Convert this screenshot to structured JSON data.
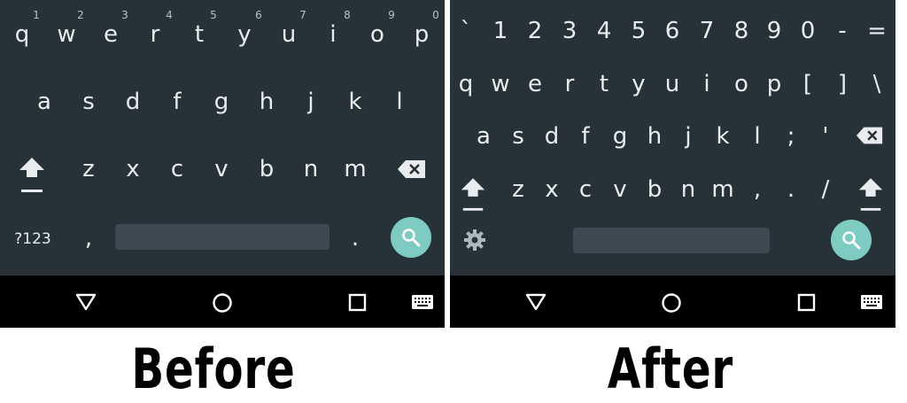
{
  "before": {
    "number_hints": [
      "1",
      "2",
      "3",
      "4",
      "5",
      "6",
      "7",
      "8",
      "9",
      "0"
    ],
    "row1": [
      "q",
      "w",
      "e",
      "r",
      "t",
      "y",
      "u",
      "i",
      "o",
      "p"
    ],
    "row2": [
      "a",
      "s",
      "d",
      "f",
      "g",
      "h",
      "j",
      "k",
      "l"
    ],
    "row3": [
      "z",
      "x",
      "c",
      "v",
      "b",
      "n",
      "m"
    ],
    "symbols_key": "?123",
    "comma": ",",
    "period": ".",
    "caption": "Before"
  },
  "after": {
    "row0": [
      "`",
      "1",
      "2",
      "3",
      "4",
      "5",
      "6",
      "7",
      "8",
      "9",
      "0",
      "-",
      "="
    ],
    "row1": [
      "q",
      "w",
      "e",
      "r",
      "t",
      "y",
      "u",
      "i",
      "o",
      "p",
      "[",
      "]",
      "\\"
    ],
    "row2": [
      "a",
      "s",
      "d",
      "f",
      "g",
      "h",
      "j",
      "k",
      "l",
      ";",
      "'"
    ],
    "row3": [
      "z",
      "x",
      "c",
      "v",
      "b",
      "n",
      "m",
      ",",
      ".",
      "/"
    ],
    "caption": "After"
  },
  "icons": {
    "shift": "shift-icon",
    "backspace": "backspace-icon",
    "search": "search-icon",
    "settings": "gear-icon",
    "nav_back": "back-triangle-icon",
    "nav_home": "home-circle-icon",
    "nav_recents": "recents-square-icon",
    "nav_keyboard": "keyboard-icon"
  },
  "colors": {
    "keyboard_bg": "#263238",
    "key_text": "#e8ecee",
    "spacebar": "#3d4a51",
    "search_button": "#7ecbc1",
    "nav_bar": "#000000"
  }
}
